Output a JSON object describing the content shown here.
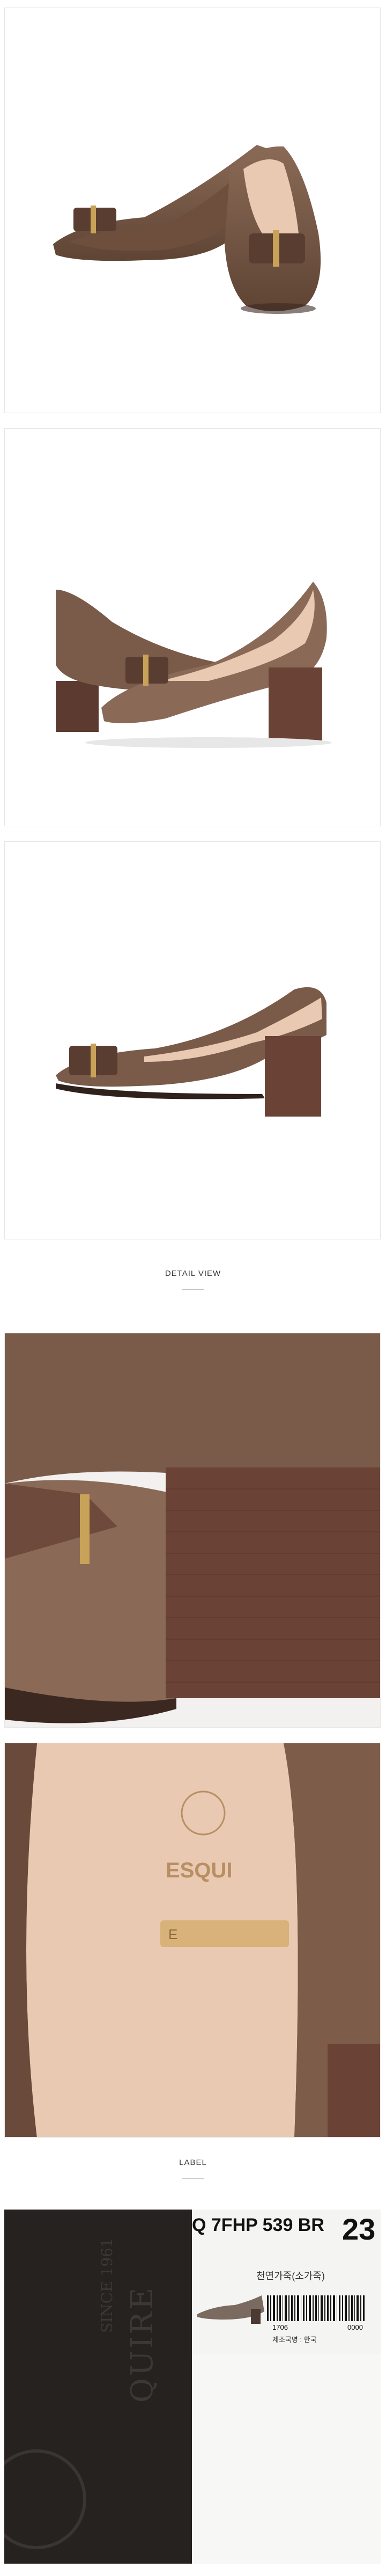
{
  "sections": {
    "detail_heading": "DETAIL VIEW",
    "label_heading": "LABEL"
  },
  "insole": {
    "brand_word": "ESQUI",
    "stamp_text": "E"
  },
  "label_photo": {
    "embossed_brand": "QUIRE",
    "embossed_since": "SINCE 1961",
    "model_code": "Q 7FHP 539 BR",
    "size_fragment": "23",
    "material_line": "천연가죽(소가죽)",
    "origin_line": "제조국명 : 한국",
    "barcode_left": "1706",
    "barcode_right": "0000"
  },
  "colors": {
    "leather": "#7a5a48",
    "lining": "#e9c9b2",
    "heel": "#5c3a30",
    "gold": "#c9a25a"
  }
}
